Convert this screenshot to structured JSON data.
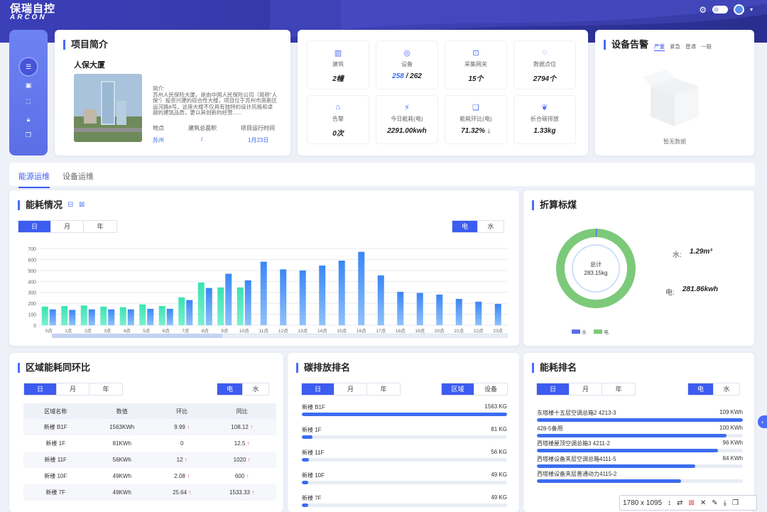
{
  "app": {
    "logo_cn": "保瑞自控",
    "logo_en": "ARCON"
  },
  "project": {
    "title": "项目简介",
    "building_name": "人保大厦",
    "intro": "简介:\n苏州人民保险大厦，是由中国人民保险公司（简称\"人保\"）投资兴建的综合性大楼，项目位于苏州市高新区运河路8号。这座大楼不仅具有独特的设计风格和卓越的建筑品质，更以其创新的经营......",
    "loc_label": "地点",
    "area_label": "建筑总面积",
    "time_label": "项目运行时间",
    "loc_value": "苏州",
    "area_value": "/",
    "time_value": "1月23日"
  },
  "stats": [
    {
      "icon": "building-icon",
      "label": "建筑",
      "value": "2幢"
    },
    {
      "icon": "device-icon",
      "label": "设备",
      "value_a": "258",
      "value_b": " / 262"
    },
    {
      "icon": "gateway-icon",
      "label": "采集网关",
      "value": "15个"
    },
    {
      "icon": "datapoint-icon",
      "label": "数据点位",
      "value": "2794个"
    },
    {
      "icon": "alarm-icon",
      "label": "告警",
      "value": "0次"
    },
    {
      "icon": "energy-icon",
      "label": "今日能耗(电)",
      "value": "2291.00kwh"
    },
    {
      "icon": "ratio-icon",
      "label": "能耗环比(电)",
      "value": "71.32% ↓"
    },
    {
      "icon": "leaf-icon",
      "label": "折合碳排放",
      "value": "1.33kg"
    }
  ],
  "alarm": {
    "title": "设备告警",
    "tabs": [
      "严重",
      "紧急",
      "普通",
      "一般"
    ],
    "empty": "暂无数据"
  },
  "tabs": [
    "能源运维",
    "设备运维"
  ],
  "energy": {
    "title": "能耗情况",
    "periods": [
      "日",
      "月",
      "年"
    ],
    "types": [
      "电",
      "水"
    ]
  },
  "chart_data": [
    {
      "type": "bar",
      "title": "",
      "categories": [
        "0点",
        "1点",
        "2点",
        "3点",
        "4点",
        "5点",
        "6点",
        "7点",
        "8点",
        "9点",
        "10点",
        "11点",
        "12点",
        "13点",
        "14点",
        "15点",
        "16点",
        "17点",
        "18点",
        "19点",
        "20点",
        "21点",
        "22点",
        "23点"
      ],
      "series": [
        {
          "values": [
            170,
            175,
            180,
            170,
            165,
            190,
            175,
            255,
            390,
            345,
            345,
            null,
            null,
            null,
            null,
            null,
            null,
            null,
            null,
            null,
            null,
            null,
            null,
            null
          ]
        },
        {
          "values": [
            145,
            140,
            145,
            145,
            145,
            150,
            150,
            230,
            340,
            470,
            410,
            580,
            510,
            500,
            545,
            590,
            670,
            455,
            305,
            295,
            280,
            240,
            215,
            195
          ]
        }
      ],
      "ylim": [
        0,
        700
      ],
      "yticks": [
        0,
        100,
        200,
        300,
        400,
        500,
        600,
        700
      ]
    },
    {
      "type": "pie",
      "title": "折算标煤",
      "center_label": "总计",
      "center_value": "283.15kg",
      "slices": [
        {
          "name": "水",
          "value": 1.29,
          "color": "#5b6fe6"
        },
        {
          "name": "电",
          "value": 281.86,
          "color": "#7cc97a"
        }
      ]
    }
  ],
  "coal": {
    "title": "折算标煤",
    "center_label": "总计",
    "center_value": "283.15kg",
    "water_label": "水:",
    "water_value": "1.29m³",
    "elec_label": "电:",
    "elec_value": "281.86kwh",
    "legend_water": "水",
    "legend_elec": "电"
  },
  "region": {
    "title": "区域能耗同环比",
    "periods": [
      "日",
      "月",
      "年"
    ],
    "types": [
      "电",
      "水"
    ],
    "headers": [
      "区域名称",
      "数值",
      "环比",
      "同比"
    ],
    "rows": [
      [
        "新楼 B1F",
        "1563KWh",
        "9.99",
        "108.12"
      ],
      [
        "新楼 1F",
        "81KWh",
        "0",
        "12.5"
      ],
      [
        "新楼 11F",
        "56KWh",
        "12",
        "1020"
      ],
      [
        "新楼 10F",
        "49KWh",
        "2.08",
        "600"
      ],
      [
        "新楼 7F",
        "49KWh",
        "25.64",
        "1533.33"
      ]
    ]
  },
  "carbon": {
    "title": "碳排放排名",
    "periods": [
      "日",
      "月",
      "年"
    ],
    "types": [
      "区域",
      "设备"
    ],
    "items": [
      {
        "name": "新楼 B1F",
        "value": "1563 KG",
        "ratio": 1.0
      },
      {
        "name": "新楼 1F",
        "value": "81 KG",
        "ratio": 0.052
      },
      {
        "name": "新楼 11F",
        "value": "56 KG",
        "ratio": 0.036
      },
      {
        "name": "新楼 10F",
        "value": "49 KG",
        "ratio": 0.031
      },
      {
        "name": "新楼 7F",
        "value": "49 KG",
        "ratio": 0.031
      }
    ]
  },
  "ranking": {
    "title": "能耗排名",
    "periods": [
      "日",
      "月",
      "年"
    ],
    "types": [
      "电",
      "水"
    ],
    "items": [
      {
        "name": "东塔楼十五层空调总箱2 4213-3",
        "value": "109 KWh",
        "ratio": 1.0
      },
      {
        "name": "428-5备用",
        "value": "100 KWh",
        "ratio": 0.92
      },
      {
        "name": "西塔楼屋顶空调总箱3 4211-2",
        "value": "96 KWh",
        "ratio": 0.88
      },
      {
        "name": "西塔楼设备夹层空调总箱4111-5",
        "value": "84 KWh",
        "ratio": 0.77
      },
      {
        "name": "西塔楼设备夹层普通动力4115-2",
        "value": "",
        "ratio": 0.7
      }
    ]
  },
  "toolbar": {
    "size": "1780 x 1095"
  }
}
